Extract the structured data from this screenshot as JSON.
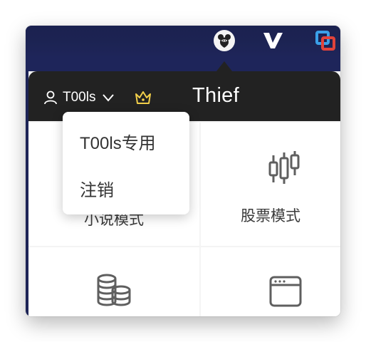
{
  "colors": {
    "menubar": "#1e255a",
    "panel_header": "#222222",
    "crown": "#f2cf4a",
    "icon_gray": "#5f5f5f",
    "text": "#333333"
  },
  "header": {
    "username": "T00ls",
    "app_title": "Thief",
    "user_icon": "user-icon",
    "dropdown_icon": "chevron-down-icon",
    "vip_icon": "crown-icon"
  },
  "user_menu": {
    "items": [
      {
        "label": "T00ls专用"
      },
      {
        "label": "注销"
      }
    ]
  },
  "modes": [
    {
      "label": "小说模式",
      "icon": "book-icon"
    },
    {
      "label": "股票模式",
      "icon": "candlestick-icon"
    },
    {
      "label": "",
      "icon": "coins-icon"
    },
    {
      "label": "",
      "icon": "window-icon"
    }
  ],
  "partial_label_visible": "小说模式"
}
